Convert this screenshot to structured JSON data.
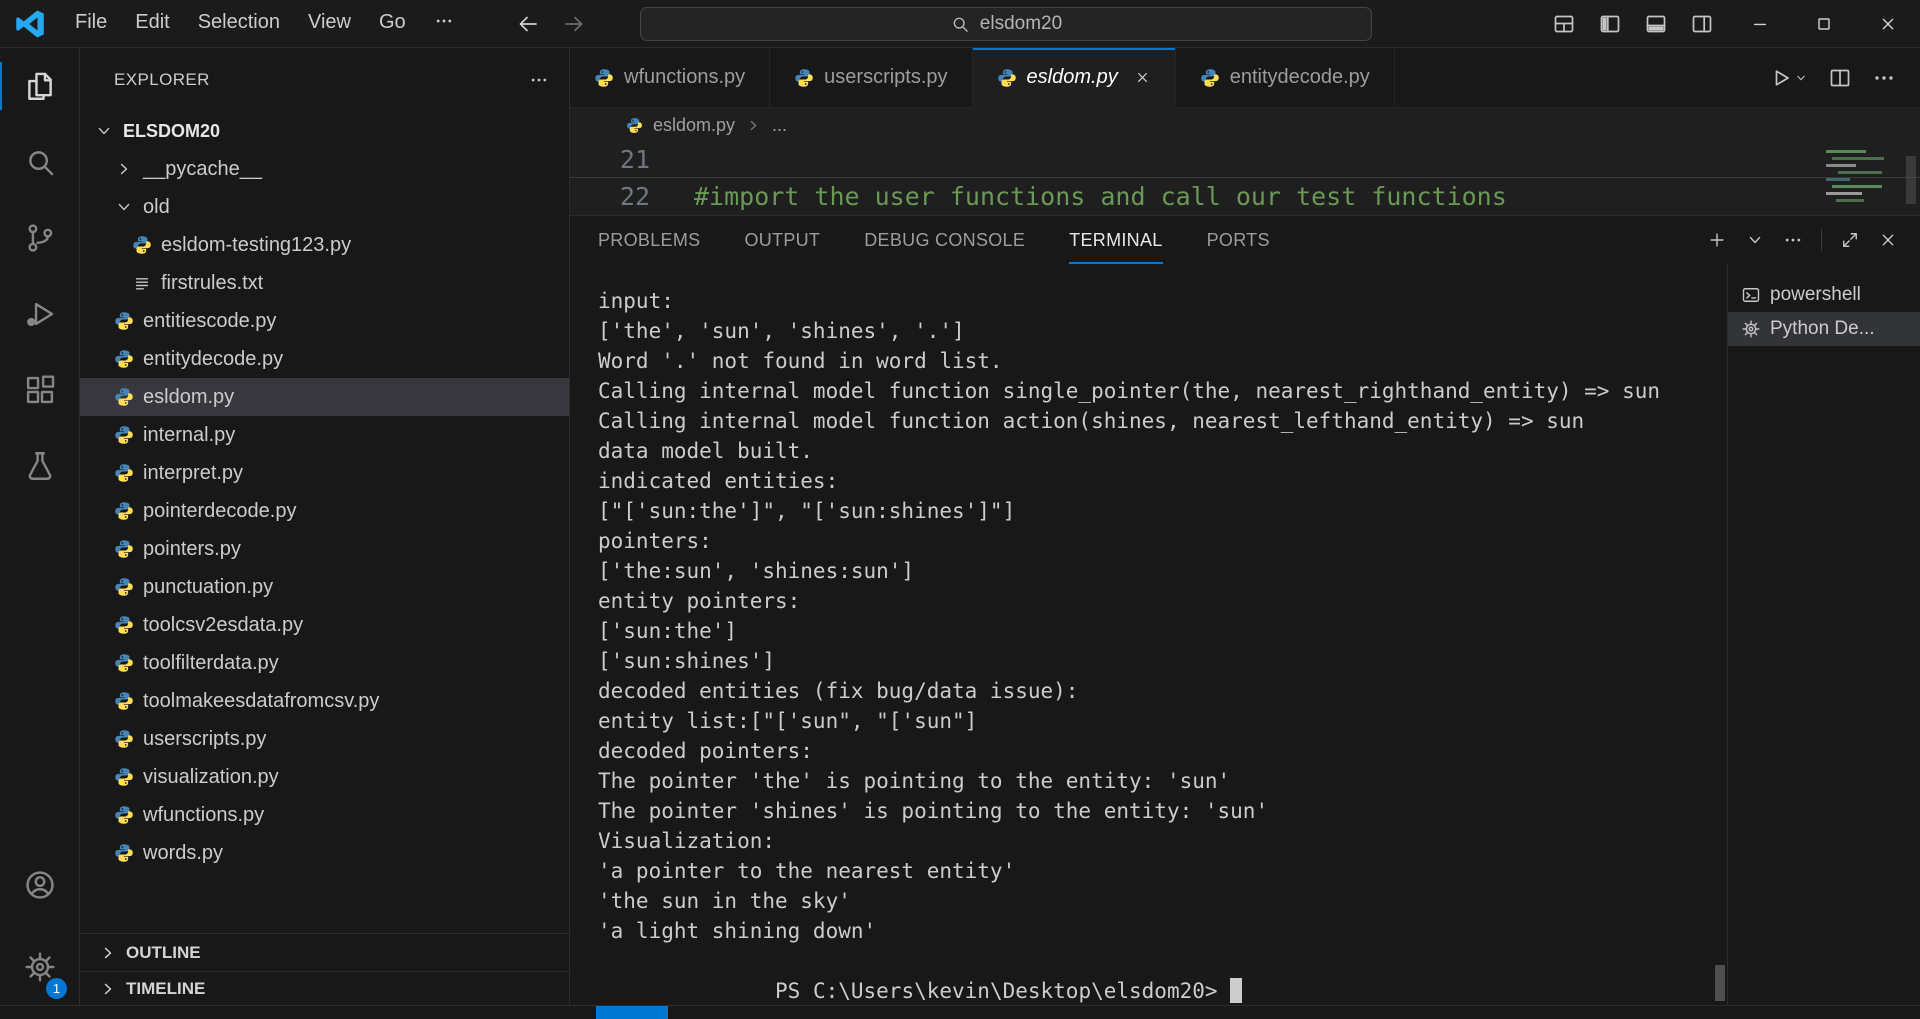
{
  "colors": {
    "accent": "#0078d4",
    "comment_green": "#6a9955",
    "python_blue": "#4584b6",
    "python_yellow": "#ffde57"
  },
  "title_bar": {
    "menus": [
      "File",
      "Edit",
      "Selection",
      "View",
      "Go"
    ],
    "more_icon": "ellipsis-icon",
    "nav": [
      {
        "name": "go-back",
        "icon": "arrow-left-icon",
        "enabled": true
      },
      {
        "name": "go-forward",
        "icon": "arrow-right-icon",
        "enabled": false
      }
    ],
    "command_center": {
      "icon": "search-icon",
      "value": "elsdom20"
    },
    "layout_actions": [
      {
        "name": "customize-layout",
        "icon": "layout-grid-icon"
      },
      {
        "name": "toggle-primary-sidebar",
        "icon": "layout-left-icon"
      },
      {
        "name": "toggle-panel",
        "icon": "layout-bottom-icon"
      },
      {
        "name": "toggle-secondary-sidebar",
        "icon": "layout-right-icon"
      }
    ],
    "window_controls": [
      {
        "name": "minimize",
        "icon": "minimize-icon"
      },
      {
        "name": "maximize",
        "icon": "maximize-icon"
      },
      {
        "name": "close",
        "icon": "close-icon"
      }
    ]
  },
  "activity_bar": {
    "top": [
      {
        "name": "explorer",
        "icon": "files-icon",
        "active": true
      },
      {
        "name": "search",
        "icon": "search-icon",
        "active": false
      },
      {
        "name": "source-control",
        "icon": "branch-icon",
        "active": false
      },
      {
        "name": "run-and-debug",
        "icon": "debug-icon",
        "active": false
      },
      {
        "name": "extensions",
        "icon": "extensions-icon",
        "active": false
      },
      {
        "name": "testing",
        "icon": "beaker-icon",
        "active": false
      }
    ],
    "bottom": [
      {
        "name": "accounts",
        "icon": "account-icon"
      },
      {
        "name": "settings",
        "icon": "gear-icon",
        "badge": "1"
      }
    ]
  },
  "explorer": {
    "title": "EXPLORER",
    "more_icon": "ellipsis-icon",
    "root_label": "ELSDOM20",
    "tree": [
      {
        "label": "__pycache__",
        "kind": "folder",
        "depth": 1,
        "expanded": false
      },
      {
        "label": "old",
        "kind": "folder",
        "depth": 1,
        "expanded": true
      },
      {
        "label": "esldom-testing123.py",
        "kind": "python",
        "depth": 2
      },
      {
        "label": "firstrules.txt",
        "kind": "text",
        "depth": 2
      },
      {
        "label": "entitiescode.py",
        "kind": "python",
        "depth": 1
      },
      {
        "label": "entitydecode.py",
        "kind": "python",
        "depth": 1
      },
      {
        "label": "esldom.py",
        "kind": "python",
        "depth": 1,
        "selected": true
      },
      {
        "label": "internal.py",
        "kind": "python",
        "depth": 1
      },
      {
        "label": "interpret.py",
        "kind": "python",
        "depth": 1
      },
      {
        "label": "pointerdecode.py",
        "kind": "python",
        "depth": 1
      },
      {
        "label": "pointers.py",
        "kind": "python",
        "depth": 1
      },
      {
        "label": "punctuation.py",
        "kind": "python",
        "depth": 1
      },
      {
        "label": "toolcsv2esdata.py",
        "kind": "python",
        "depth": 1
      },
      {
        "label": "toolfilterdata.py",
        "kind": "python",
        "depth": 1
      },
      {
        "label": "toolmakeesdatafromcsv.py",
        "kind": "python",
        "depth": 1
      },
      {
        "label": "userscripts.py",
        "kind": "python",
        "depth": 1
      },
      {
        "label": "visualization.py",
        "kind": "python",
        "depth": 1
      },
      {
        "label": "wfunctions.py",
        "kind": "python",
        "depth": 1
      },
      {
        "label": "words.py",
        "kind": "python",
        "depth": 1
      }
    ],
    "sections": [
      "OUTLINE",
      "TIMELINE"
    ]
  },
  "editor": {
    "tabs": [
      {
        "label": "wfunctions.py",
        "active": false
      },
      {
        "label": "userscripts.py",
        "active": false
      },
      {
        "label": "esldom.py",
        "active": true,
        "preview": true
      },
      {
        "label": "entitydecode.py",
        "active": false
      }
    ],
    "actions": [
      {
        "name": "run-python-file",
        "icon": "play-icon"
      },
      {
        "name": "split-editor",
        "icon": "split-icon"
      },
      {
        "name": "editor-more-actions",
        "icon": "ellipsis-icon"
      }
    ],
    "breadcrumb": {
      "file": "esldom.py",
      "more": "..."
    },
    "code": [
      {
        "line": 21,
        "text": ""
      },
      {
        "line": 22,
        "text": "#import the user functions and call our test functions",
        "token": "comment"
      }
    ]
  },
  "panel": {
    "tabs": [
      {
        "label": "PROBLEMS",
        "active": false
      },
      {
        "label": "OUTPUT",
        "active": false
      },
      {
        "label": "DEBUG CONSOLE",
        "active": false
      },
      {
        "label": "TERMINAL",
        "active": true
      },
      {
        "label": "PORTS",
        "active": false
      }
    ],
    "actions": [
      {
        "name": "new-terminal",
        "icon": "plus-icon"
      },
      {
        "name": "launch-profile-dropdown",
        "icon": "chevron-down-icon"
      },
      {
        "name": "panel-more-actions",
        "icon": "ellipsis-icon"
      },
      {
        "name": "separator",
        "icon": ""
      },
      {
        "name": "maximize-panel",
        "icon": "expand-icon"
      },
      {
        "name": "close-panel",
        "icon": "close-icon"
      }
    ],
    "terminal": {
      "lines": [
        "input:",
        "['the', 'sun', 'shines', '.']",
        "Word '.' not found in word list.",
        "Calling internal model function single_pointer(the, nearest_righthand_entity) => sun",
        "Calling internal model function action(shines, nearest_lefthand_entity) => sun",
        "data model built.",
        "indicated entities:",
        "[\"['sun:the']\", \"['sun:shines']\"]",
        "pointers:",
        "['the:sun', 'shines:sun']",
        "entity pointers:",
        "['sun:the']",
        "['sun:shines']",
        "decoded entities (fix bug/data issue):",
        "entity list:[\"['sun\", \"['sun\"]",
        "decoded pointers:",
        "The pointer 'the' is pointing to the entity: 'sun'",
        "The pointer 'shines' is pointing to the entity: 'sun'",
        "Visualization:",
        "'a pointer to the nearest entity'",
        "'the sun in the sky'",
        "'a light shining down'"
      ],
      "prompt": "PS C:\\Users\\kevin\\Desktop\\elsdom20>"
    },
    "terminal_list": [
      {
        "label": "powershell",
        "icon": "terminal-icon",
        "selected": false
      },
      {
        "label": "Python De...",
        "icon": "gear-icon",
        "selected": true
      }
    ]
  }
}
